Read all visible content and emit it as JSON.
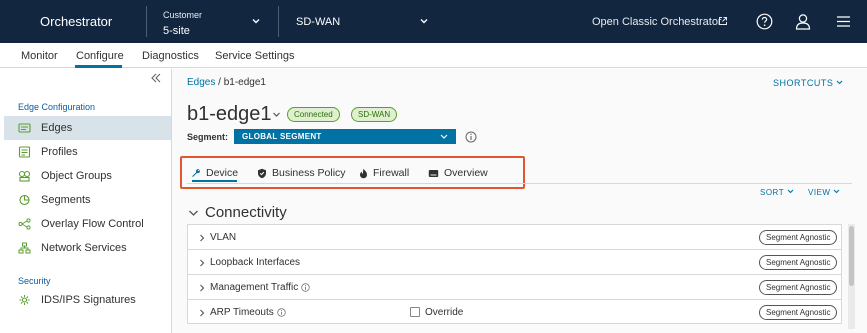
{
  "header": {
    "app_title": "Orchestrator",
    "customer_label": "Customer",
    "customer_value": "5-site",
    "product": "SD-WAN",
    "open_classic": "Open Classic Orchestrator"
  },
  "nav": {
    "tabs": [
      {
        "label": "Monitor"
      },
      {
        "label": "Configure",
        "active": true
      },
      {
        "label": "Diagnostics"
      },
      {
        "label": "Service Settings"
      }
    ]
  },
  "sidebar": {
    "sections": [
      {
        "title": "Edge Configuration",
        "items": [
          {
            "label": "Edges",
            "icon": "edges-icon",
            "active": true
          },
          {
            "label": "Profiles",
            "icon": "profiles-icon"
          },
          {
            "label": "Object Groups",
            "icon": "object-groups-icon"
          },
          {
            "label": "Segments",
            "icon": "segments-icon"
          },
          {
            "label": "Overlay Flow Control",
            "icon": "overlay-flow-icon"
          },
          {
            "label": "Network Services",
            "icon": "network-services-icon"
          }
        ]
      },
      {
        "title": "Security",
        "items": [
          {
            "label": "IDS/IPS Signatures",
            "icon": "ids-ips-icon"
          }
        ]
      }
    ]
  },
  "main": {
    "breadcrumb": {
      "link": "Edges",
      "separator": "/",
      "current": "b1-edge1"
    },
    "shortcuts": "SHORTCUTS",
    "title": "b1-edge1",
    "badges": [
      "Connected",
      "SD-WAN"
    ],
    "segment_label": "Segment:",
    "segment_value": "GLOBAL SEGMENT",
    "tabs": [
      {
        "label": "Device",
        "icon": "wrench-icon",
        "active": true
      },
      {
        "label": "Business Policy",
        "icon": "shield-icon"
      },
      {
        "label": "Firewall",
        "icon": "flame-icon"
      },
      {
        "label": "Overview",
        "icon": "overview-icon"
      }
    ],
    "sort": "SORT",
    "view": "VIEW",
    "section_title": "Connectivity",
    "rows": [
      {
        "label": "VLAN",
        "info": false,
        "override": false,
        "tag": "Segment Agnostic"
      },
      {
        "label": "Loopback Interfaces",
        "info": false,
        "override": false,
        "tag": "Segment Agnostic"
      },
      {
        "label": "Management Traffic",
        "info": true,
        "override": false,
        "tag": "Segment Agnostic"
      },
      {
        "label": "ARP Timeouts",
        "info": true,
        "override": true,
        "override_label": "Override",
        "tag": "Segment Agnostic"
      }
    ]
  },
  "colors": {
    "header_bg": "#12263f",
    "accent": "#0072a3",
    "highlight_border": "#e2572f",
    "badge_green": "#5b9e2f"
  }
}
